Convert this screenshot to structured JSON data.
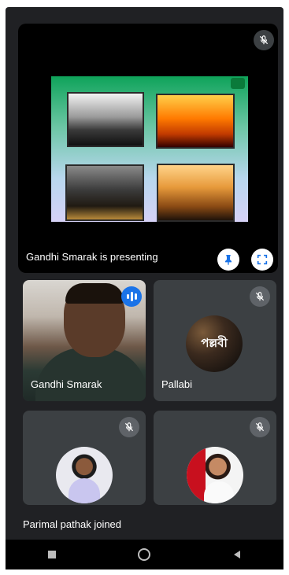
{
  "presentation": {
    "label": "Gandhi Smarak is presenting",
    "icons": {
      "muted": "mic-off-icon",
      "pin": "pin-icon",
      "fullscreen": "fullscreen-icon"
    }
  },
  "participants": [
    {
      "name": "Gandhi Smarak",
      "status": "speaking",
      "status_icon": "audio-wave-icon"
    },
    {
      "name": "Pallabi",
      "status": "muted",
      "avatar_text": "পল্লবী"
    },
    {
      "name": "",
      "status": "muted"
    },
    {
      "name": "",
      "status": "muted"
    }
  ],
  "toast": {
    "text": "Parimal pathak joined"
  },
  "navigation": {
    "icons": [
      "recents-icon",
      "home-icon",
      "back-icon"
    ]
  },
  "colors": {
    "background": "#202124",
    "tile": "#3c4043",
    "accent": "#1a73e8"
  }
}
